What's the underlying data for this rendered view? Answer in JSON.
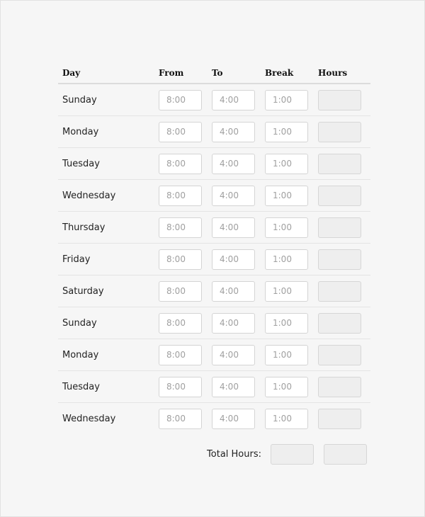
{
  "table": {
    "headers": {
      "day": "Day",
      "from": "From",
      "to": "To",
      "break": "Break",
      "hours": "Hours"
    },
    "rows": [
      {
        "day": "Sunday",
        "from_placeholder": "8:00",
        "to_placeholder": "4:00",
        "break_placeholder": "1:00",
        "hours": ""
      },
      {
        "day": "Monday",
        "from_placeholder": "8:00",
        "to_placeholder": "4:00",
        "break_placeholder": "1:00",
        "hours": ""
      },
      {
        "day": "Tuesday",
        "from_placeholder": "8:00",
        "to_placeholder": "4:00",
        "break_placeholder": "1:00",
        "hours": ""
      },
      {
        "day": "Wednesday",
        "from_placeholder": "8:00",
        "to_placeholder": "4:00",
        "break_placeholder": "1:00",
        "hours": ""
      },
      {
        "day": "Thursday",
        "from_placeholder": "8:00",
        "to_placeholder": "4:00",
        "break_placeholder": "1:00",
        "hours": ""
      },
      {
        "day": "Friday",
        "from_placeholder": "8:00",
        "to_placeholder": "4:00",
        "break_placeholder": "1:00",
        "hours": ""
      },
      {
        "day": "Saturday",
        "from_placeholder": "8:00",
        "to_placeholder": "4:00",
        "break_placeholder": "1:00",
        "hours": ""
      },
      {
        "day": "Sunday",
        "from_placeholder": "8:00",
        "to_placeholder": "4:00",
        "break_placeholder": "1:00",
        "hours": ""
      },
      {
        "day": "Monday",
        "from_placeholder": "8:00",
        "to_placeholder": "4:00",
        "break_placeholder": "1:00",
        "hours": ""
      },
      {
        "day": "Tuesday",
        "from_placeholder": "8:00",
        "to_placeholder": "4:00",
        "break_placeholder": "1:00",
        "hours": ""
      },
      {
        "day": "Wednesday",
        "from_placeholder": "8:00",
        "to_placeholder": "4:00",
        "break_placeholder": "1:00",
        "hours": ""
      }
    ]
  },
  "totals": {
    "label": "Total Hours:",
    "total_a": "",
    "total_b": ""
  }
}
